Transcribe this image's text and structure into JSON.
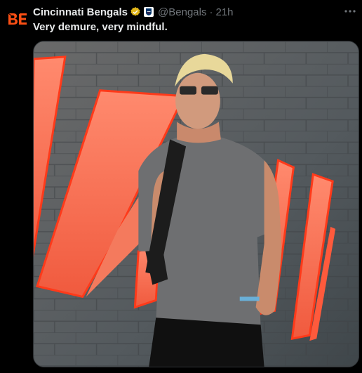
{
  "tweet": {
    "author_name": "Cincinnati Bengals",
    "handle": "@Bengals",
    "separator": "·",
    "time": "21h",
    "text": "Very demure, very mindful.",
    "more_icon": "more-horizontal-icon",
    "avatar_icon": "bengals-logo-icon",
    "verified_icon": "gold-verified-badge-icon",
    "affiliate_icon": "nfl-shield-icon",
    "media_alt": "photo-player-walking-past-orange-sign",
    "colors": {
      "text": "#e7e9ea",
      "muted": "#71767b",
      "verified": "#e2b719",
      "brand_orange": "#fb4f14"
    }
  }
}
